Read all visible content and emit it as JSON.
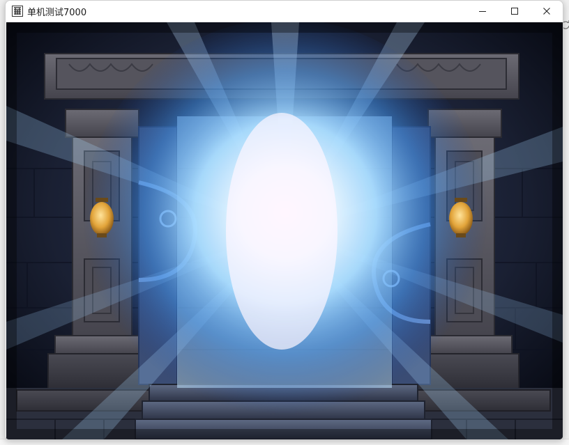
{
  "window": {
    "title": "单机测试7000",
    "app_icon": "app-character-icon"
  },
  "controls": {
    "minimize": "minimize-icon",
    "maximize": "maximize-icon",
    "close": "close-icon"
  },
  "scene": {
    "description_icon": "portal-gate-scene"
  },
  "colors": {
    "portal_glow": "#dff2ff",
    "portal_blue": "#3a8fe0",
    "stone": "#5b5a63",
    "lamp": "#e2a43a"
  }
}
